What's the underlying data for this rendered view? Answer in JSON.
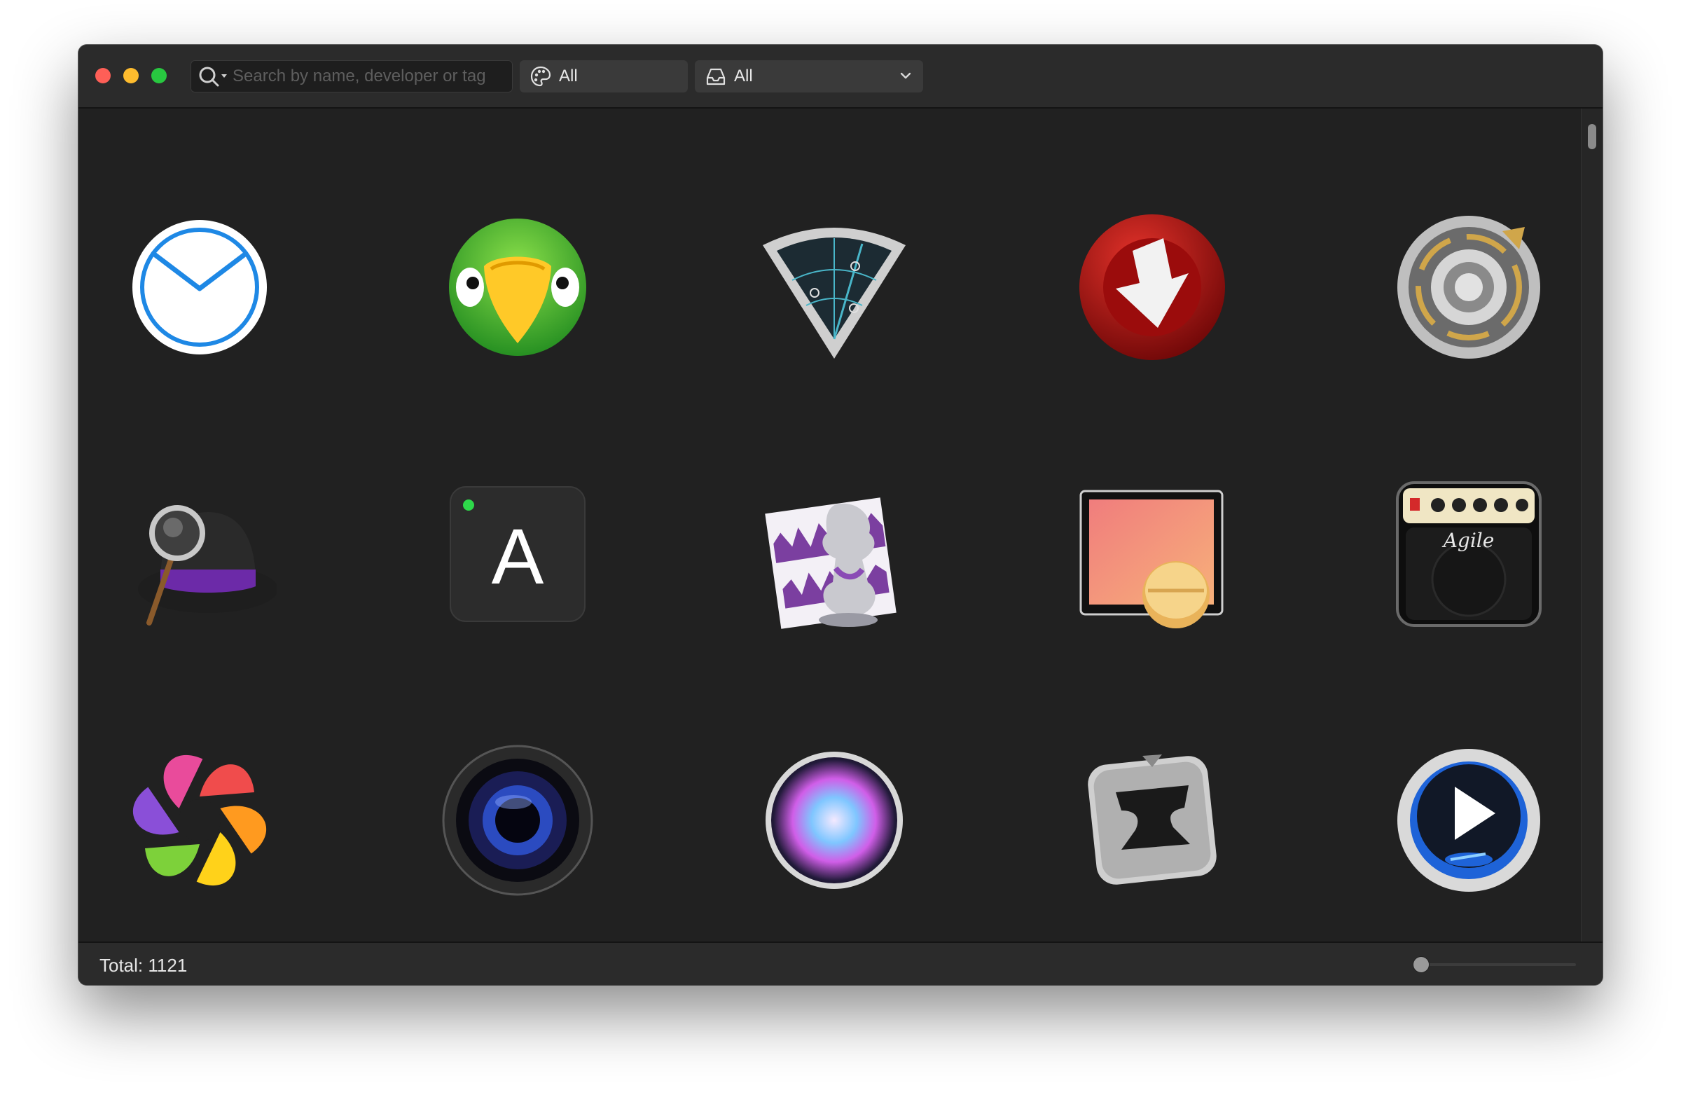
{
  "toolbar": {
    "search": {
      "placeholder": "Search by name, developer or tag",
      "value": ""
    },
    "theme_filter": {
      "selected": "All",
      "icon": "palette-icon"
    },
    "source_filter": {
      "selected": "All",
      "icon": "tray-icon"
    }
  },
  "apps": [
    {
      "icon": "airmail-envelope-icon"
    },
    {
      "icon": "parrot-icon"
    },
    {
      "icon": "wifi-radar-icon"
    },
    {
      "icon": "red-download-arrow-icon"
    },
    {
      "icon": "metal-vault-dial-icon"
    },
    {
      "icon": "hat-magnifier-icon"
    },
    {
      "icon": "letter-a-keycap-icon",
      "glyph": "A"
    },
    {
      "icon": "composer-bust-waveform-icon"
    },
    {
      "icon": "window-pill-icon"
    },
    {
      "icon": "guitar-amp-icon",
      "glyph": "Agile"
    },
    {
      "icon": "color-flower-icon"
    },
    {
      "icon": "camera-lens-icon"
    },
    {
      "icon": "voice-orb-icon"
    },
    {
      "icon": "anvil-icon"
    },
    {
      "icon": "bluray-play-icon"
    }
  ],
  "status": {
    "total_label": "Total: 1121"
  },
  "colors": {
    "window_bg": "#212121",
    "toolbar_bg": "#2b2b2b",
    "close": "#fe5f57",
    "minimize": "#febc2e",
    "maximize": "#28c840"
  }
}
